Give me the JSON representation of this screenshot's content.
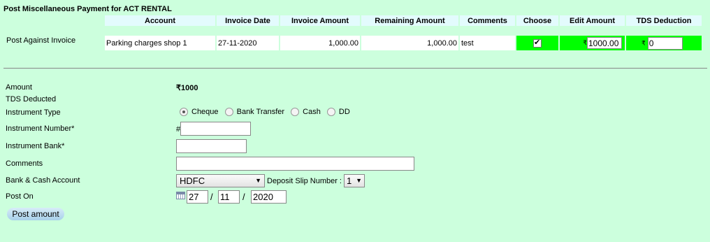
{
  "page": {
    "title": "Post Miscellaneous Payment for ACT RENTAL"
  },
  "table": {
    "headers": [
      "Account",
      "Invoice Date",
      "Invoice Amount",
      "Remaining Amount",
      "Comments",
      "Choose",
      "Edit Amount",
      "TDS Deduction"
    ],
    "row_label": "Post Against Invoice",
    "rows": [
      {
        "account": "Parking charges shop 1",
        "invoice_date": "27-11-2020",
        "invoice_amount": "1,000.00",
        "remaining_amount": "1,000.00",
        "comments": "test",
        "choose_checked": true,
        "currency_symbol": "₹",
        "edit_amount": "1000.00",
        "tds_deduction": "0"
      }
    ]
  },
  "form": {
    "amount_label": "Amount",
    "amount_value": "₹1000",
    "tds_label": "TDS Deducted",
    "instrument_type_label": "Instrument Type",
    "instrument_types": [
      {
        "label": "Cheque",
        "selected": true
      },
      {
        "label": "Bank Transfer",
        "selected": false
      },
      {
        "label": "Cash",
        "selected": false
      },
      {
        "label": "DD",
        "selected": false
      }
    ],
    "instrument_number_label": "Instrument Number*",
    "instrument_number_prefix": "#",
    "instrument_number_value": "",
    "instrument_bank_label": "Instrument Bank*",
    "instrument_bank_value": "",
    "comments_label": "Comments",
    "comments_value": "",
    "bank_account_label": "Bank & Cash Account",
    "bank_account_value": "HDFC",
    "deposit_slip_label": "Deposit Slip Number :",
    "deposit_slip_value": "1",
    "post_on_label": "Post On",
    "post_on_day": "27",
    "post_on_month": "11",
    "post_on_year": "2020",
    "date_separator": "/",
    "post_button_label": "Post amount"
  },
  "colors": {
    "background": "#ccffdd",
    "header_cell": "#e3fbfd",
    "highlight_green": "#00ff00",
    "button": "#a8d0ea"
  },
  "icons": {
    "calendar": "calendar-icon",
    "dropdown": "chevron-down-icon"
  }
}
